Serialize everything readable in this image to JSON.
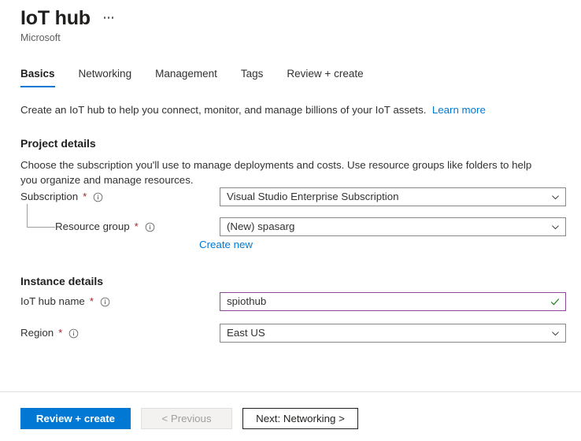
{
  "header": {
    "title": "IoT hub",
    "subtitle": "Microsoft",
    "more_menu": "more-options"
  },
  "tabs": [
    {
      "label": "Basics",
      "active": true
    },
    {
      "label": "Networking",
      "active": false
    },
    {
      "label": "Management",
      "active": false
    },
    {
      "label": "Tags",
      "active": false
    },
    {
      "label": "Review + create",
      "active": false
    }
  ],
  "intro": {
    "text": "Create an IoT hub to help you connect, monitor, and manage billions of your IoT assets.",
    "link_label": "Learn more"
  },
  "project_details": {
    "heading": "Project details",
    "description": "Choose the subscription you'll use to manage deployments and costs. Use resource groups like folders to help you organize and manage resources.",
    "subscription": {
      "label": "Subscription",
      "required": "*",
      "value": "Visual Studio Enterprise Subscription"
    },
    "resource_group": {
      "label": "Resource group",
      "required": "*",
      "value": "(New) spasarg",
      "create_new_label": "Create new"
    }
  },
  "instance_details": {
    "heading": "Instance details",
    "iot_hub_name": {
      "label": "IoT hub name",
      "required": "*",
      "value": "spiothub",
      "validation": "valid"
    },
    "region": {
      "label": "Region",
      "required": "*",
      "value": "East US"
    }
  },
  "footer": {
    "review_create": "Review + create",
    "previous": "< Previous",
    "next": "Next: Networking >"
  },
  "colors": {
    "accent": "#0078d4",
    "required_asterisk": "#a4262c",
    "focus_border": "#8e4b99",
    "valid_check": "#107c10",
    "border": "#8a8886"
  }
}
